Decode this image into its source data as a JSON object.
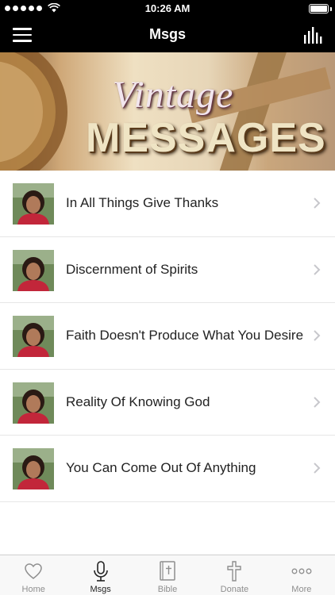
{
  "status_bar": {
    "time": "10:26 AM"
  },
  "nav": {
    "title": "Msgs"
  },
  "banner": {
    "script_text": "Vintage",
    "block_text": "MESSAGES"
  },
  "messages": [
    {
      "title": "In All Things Give Thanks"
    },
    {
      "title": "Discernment of Spirits"
    },
    {
      "title": "Faith Doesn't Produce What You Desire"
    },
    {
      "title": "Reality Of Knowing God"
    },
    {
      "title": "You Can Come Out Of Anything"
    }
  ],
  "tabs": [
    {
      "label": "Home",
      "icon": "heart-icon",
      "active": false
    },
    {
      "label": "Msgs",
      "icon": "microphone-icon",
      "active": true
    },
    {
      "label": "Bible",
      "icon": "bible-icon",
      "active": false
    },
    {
      "label": "Donate",
      "icon": "cross-icon",
      "active": false
    },
    {
      "label": "More",
      "icon": "more-icon",
      "active": false
    }
  ],
  "colors": {
    "bar": "#000000",
    "tab_inactive": "#8e8e8e",
    "tab_active": "#222222"
  }
}
